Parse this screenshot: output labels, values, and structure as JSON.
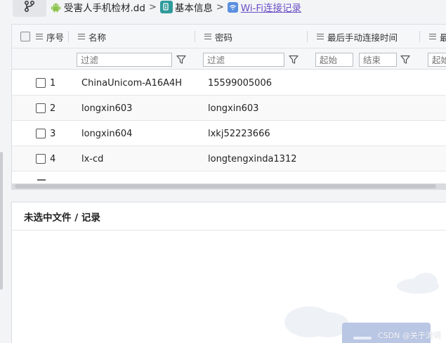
{
  "breadcrumb": {
    "items": [
      "受害人手机检材.dd",
      "基本信息",
      "Wi-Fi连接记录"
    ],
    "separator": ">"
  },
  "table": {
    "columns": [
      "序号",
      "名称",
      "密码",
      "最后手动连接时间",
      "最"
    ],
    "filters": {
      "name_placeholder": "过滤",
      "password_placeholder": "过滤",
      "start_placeholder": "起始",
      "end_placeholder": "结束",
      "start_placeholder_2": "起始"
    },
    "rows": [
      {
        "index": "1",
        "name": "ChinaUnicom-A16A4H",
        "password": "15599005006"
      },
      {
        "index": "2",
        "name": "longxin603",
        "password": "longxin603"
      },
      {
        "index": "3",
        "name": "longxin604",
        "password": "lxkj52223666"
      },
      {
        "index": "4",
        "name": "lx-cd",
        "password": "longtengxinda1312"
      }
    ]
  },
  "detail": {
    "title": "未选中文件 / 记录"
  },
  "watermark": "CSDN @关于清词",
  "colors": {
    "accent": "#6b4fc7",
    "info_icon": "#2f9a9a",
    "wifi_icon": "#5a8fe0",
    "android": "#8bc34a"
  }
}
